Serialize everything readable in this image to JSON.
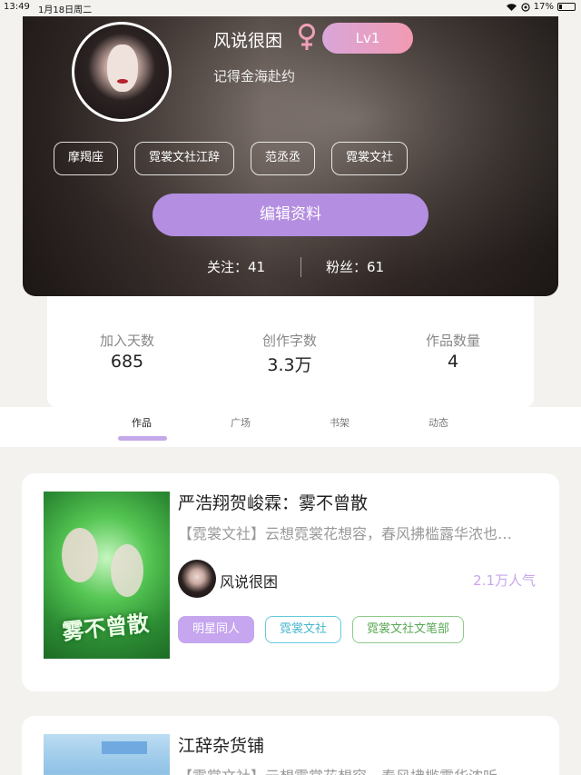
{
  "status": {
    "time": "13:49",
    "date": "1月18日周二",
    "battery": "17%"
  },
  "profile": {
    "username": "风说很困",
    "level": "Lv1",
    "signature": "记得金海赴约",
    "tags": [
      "摩羯座",
      "霓裳文社江辞",
      "范丞丞",
      "霓裳文社"
    ],
    "edit_label": "编辑资料",
    "following": "关注：41",
    "fans": "粉丝：61"
  },
  "stats": [
    {
      "label": "加入天数",
      "value": "685"
    },
    {
      "label": "创作字数",
      "value": "3.3万"
    },
    {
      "label": "作品数量",
      "value": "4"
    }
  ],
  "tabs": [
    "作品",
    "广场",
    "书架",
    "动态"
  ],
  "works": [
    {
      "cover_title": "雾不曾散",
      "title": "严浩翔贺峻霖：雾不曾散",
      "desc": "【霓裳文社】云想霓裳花想容，春风拂槛露华浓也…",
      "author": "风说很困",
      "popularity": "2.1万人气",
      "tags": [
        "明星同人",
        "霓裳文社",
        "霓裳文社文笔部"
      ]
    },
    {
      "title": "江辞杂货铺",
      "desc": "【霓裳文社】云想霓裳花想容，春风拂槛露华浓听"
    }
  ],
  "colors": {
    "accent": "#b48ee0",
    "popularity": "#c8a6ec",
    "level_badge": "#f29ab3"
  }
}
